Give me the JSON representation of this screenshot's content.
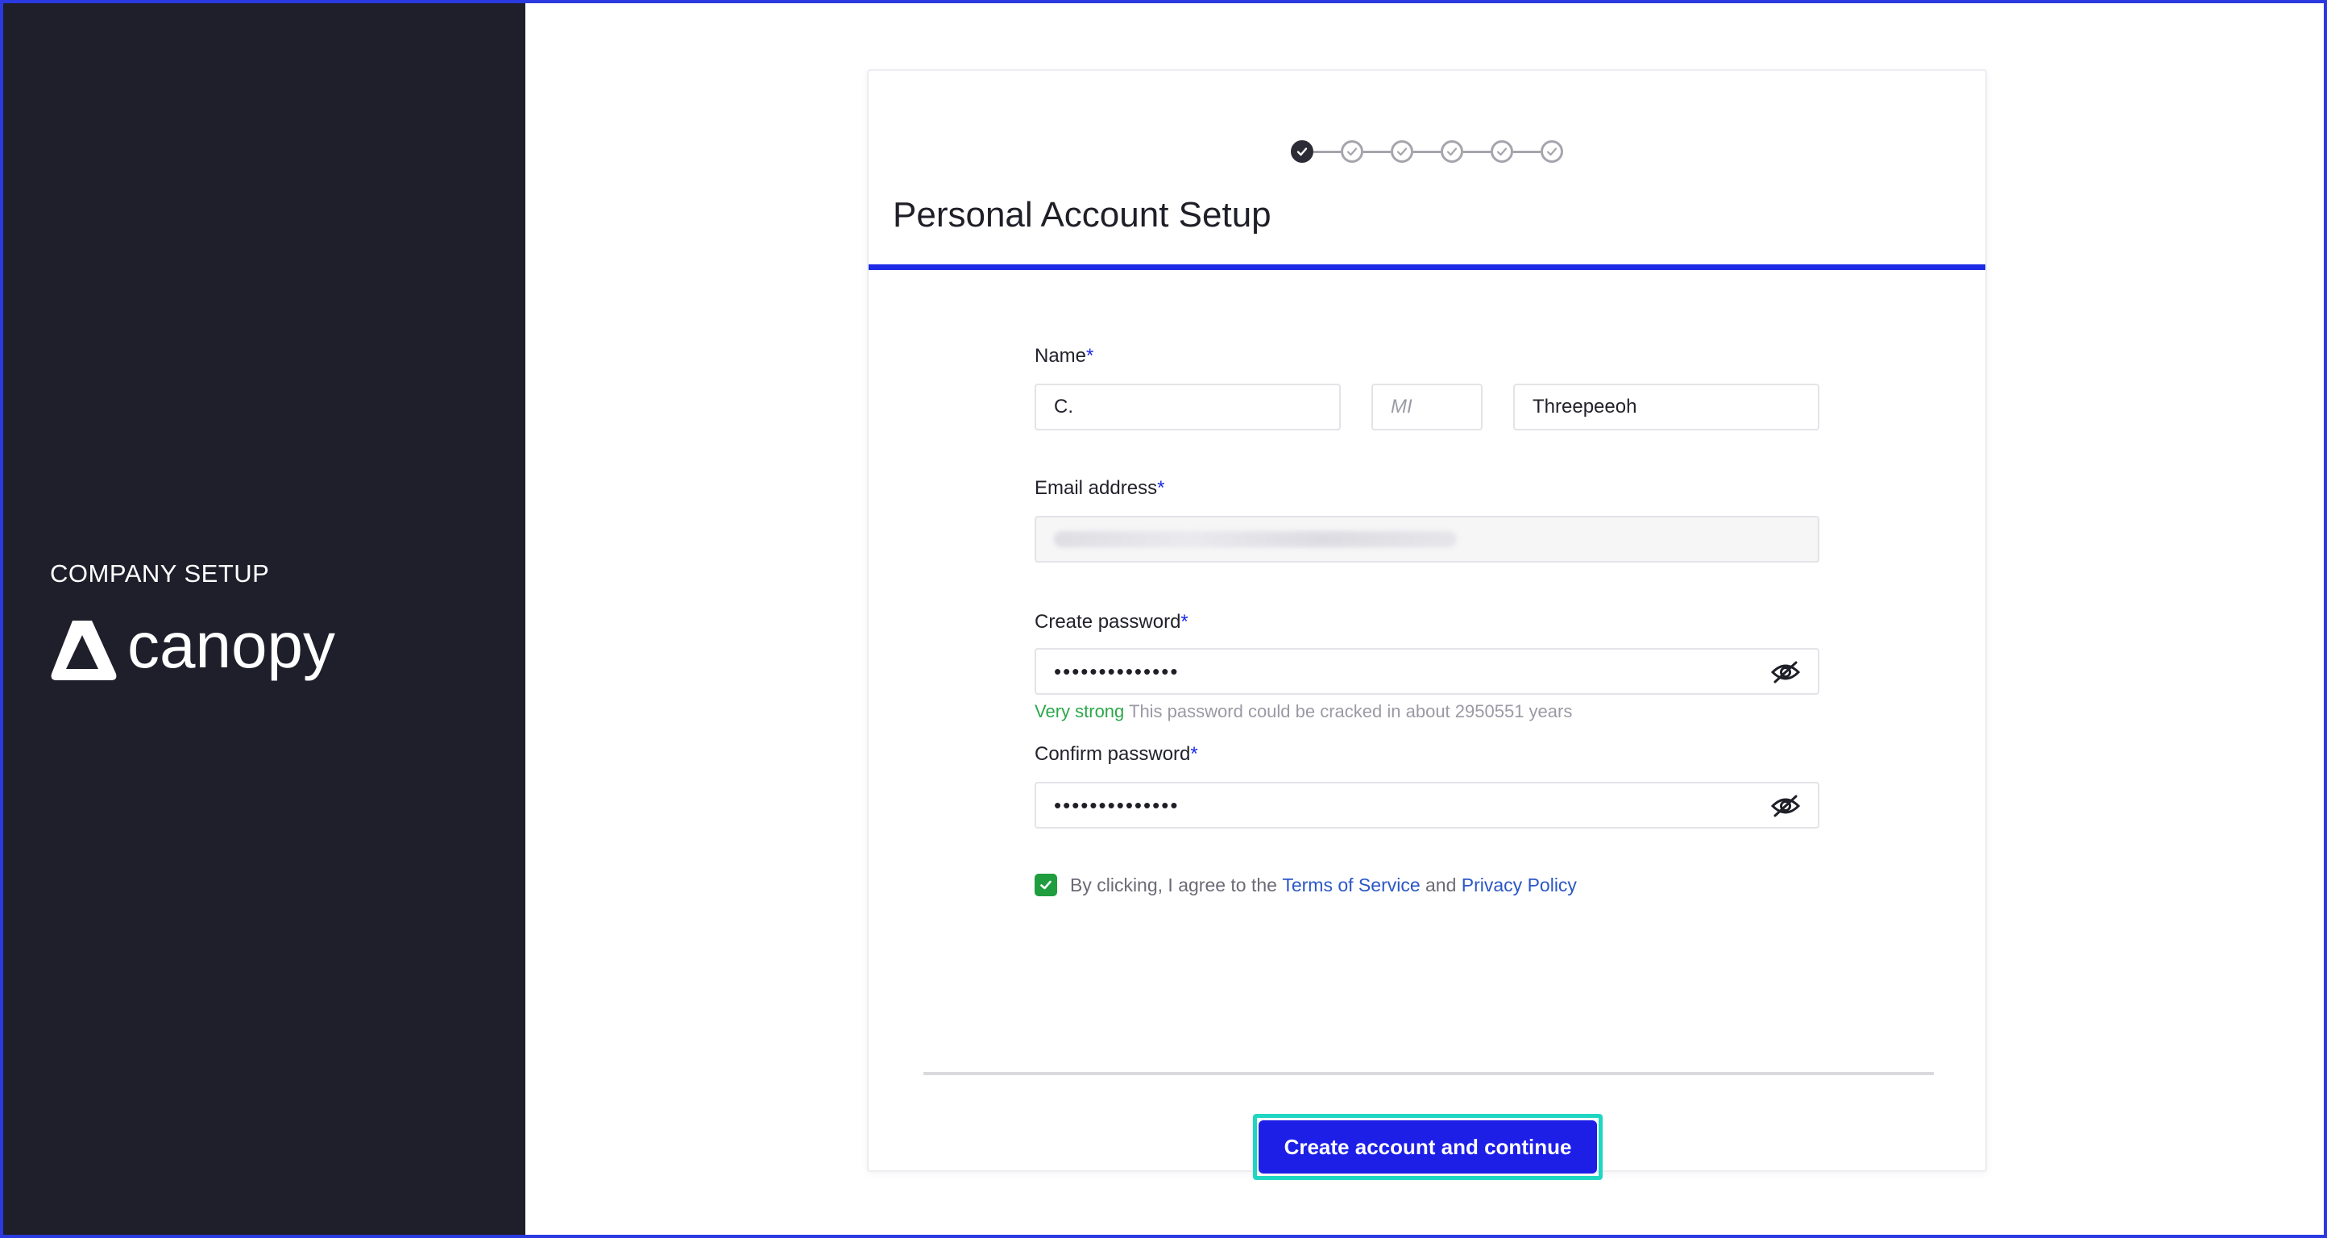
{
  "sidebar": {
    "eyebrow": "COMPANY SETUP",
    "brand_name": "canopy",
    "logo_icon": "canopy-triangle-logo"
  },
  "stepper": {
    "total_steps": 6,
    "current_step": 1
  },
  "card": {
    "title": "Personal Account Setup"
  },
  "form": {
    "name_label": "Name",
    "required_mark": "*",
    "first_name_value": "C.",
    "middle_initial_placeholder": "MI",
    "last_name_value": "Threepeeoh",
    "email_label": "Email address",
    "create_password_label": "Create password",
    "password_masked": "••••••••••••••",
    "strength_label": "Very strong",
    "strength_hint": "This password could be cracked in about 2950551 years",
    "confirm_password_label": "Confirm password",
    "confirm_password_masked": "••••••••••••••",
    "agree_prefix": "By clicking, I agree to the",
    "terms_link": "Terms of Service",
    "agree_and": "and",
    "privacy_link": "Privacy Policy",
    "agree_checked": true
  },
  "actions": {
    "submit_label": "Create account and continue"
  },
  "colors": {
    "sidebar_bg": "#1f1e2b",
    "accent": "#1d2be6",
    "button": "#1d1fe6",
    "focus_ring": "#1fd6c3",
    "strength_good": "#2ba84a",
    "link": "#2b57c6",
    "checkbox": "#1f9d3f"
  },
  "icons": {
    "step_check": "check-icon",
    "eye": "eye-slash-icon",
    "checkbox": "checkmark-icon"
  }
}
